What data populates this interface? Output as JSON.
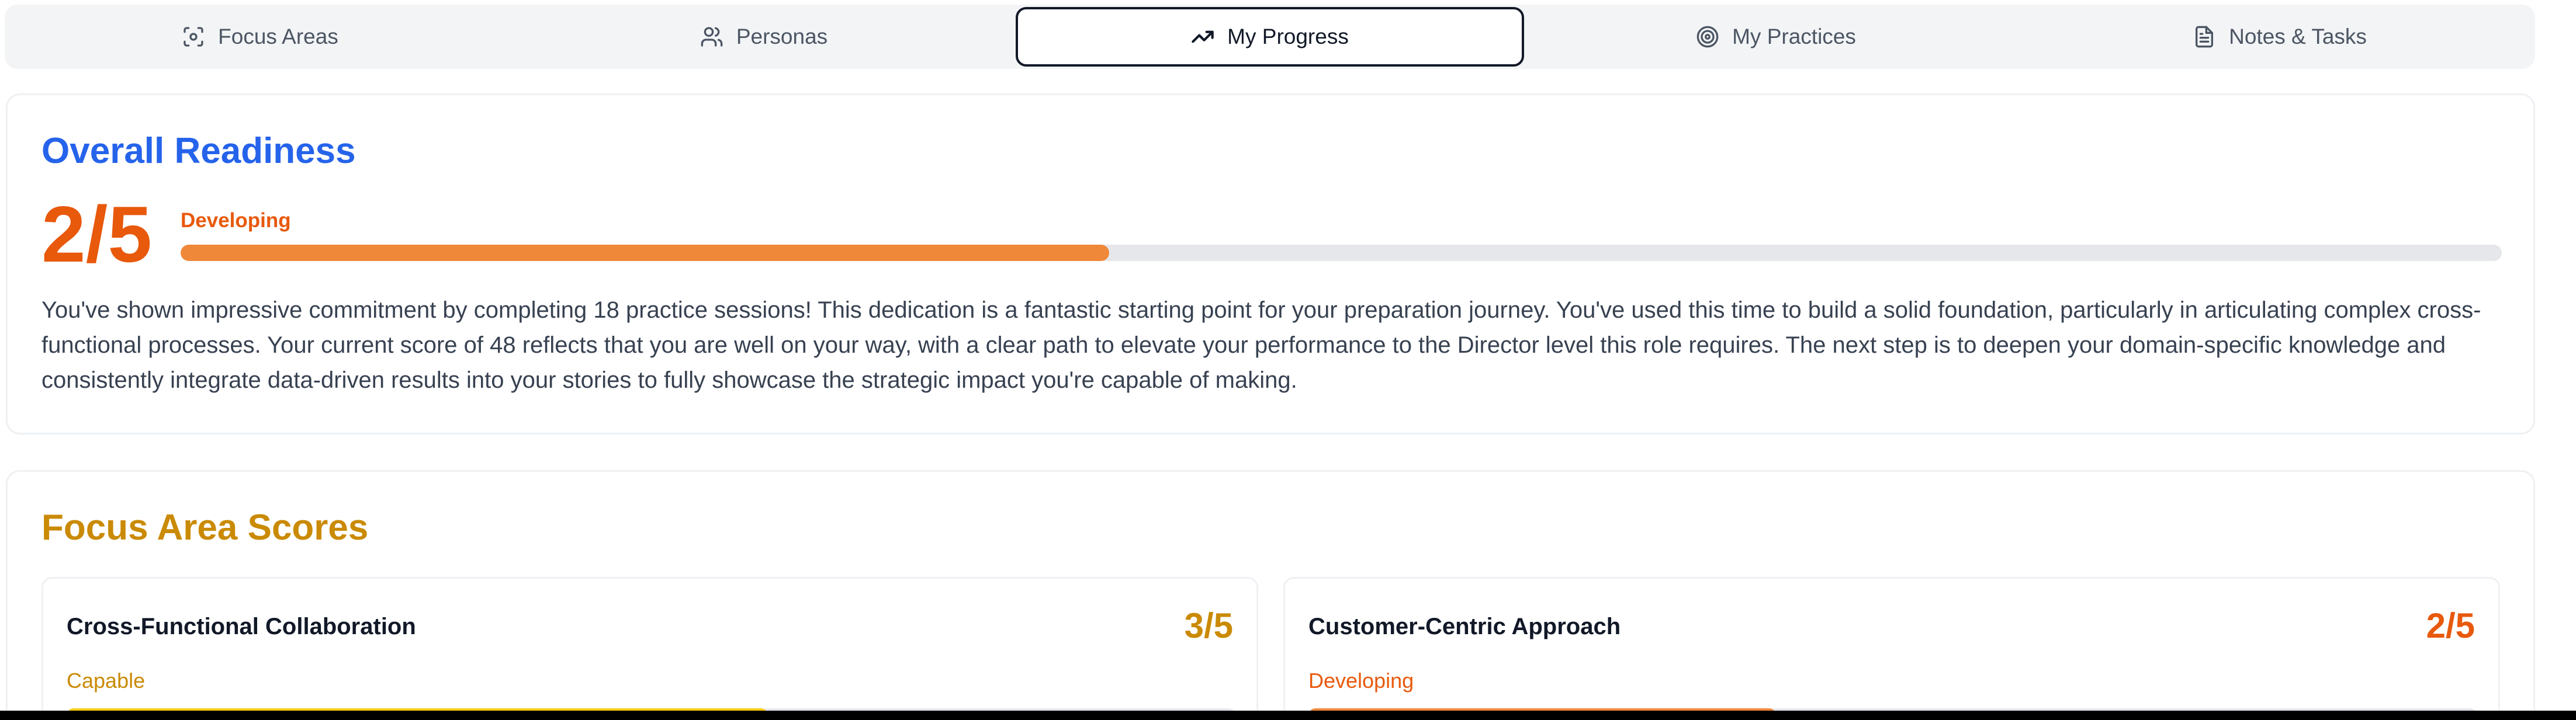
{
  "tabs": [
    {
      "label": "Focus Areas",
      "icon": "focus-icon",
      "active": false
    },
    {
      "label": "Personas",
      "icon": "users-icon",
      "active": false
    },
    {
      "label": "My Progress",
      "icon": "trending-up-icon",
      "active": true
    },
    {
      "label": "My Practices",
      "icon": "target-icon",
      "active": false
    },
    {
      "label": "Notes & Tasks",
      "icon": "file-text-icon",
      "active": false
    }
  ],
  "readiness": {
    "title": "Overall Readiness",
    "score": "2/5",
    "level": "Developing",
    "progress_fraction": 0.4,
    "summary": "You've shown impressive commitment by completing 18 practice sessions! This dedication is a fantastic starting point for your preparation journey. You've used this time to build a solid foundation, particularly in articulating complex cross-functional processes. Your current score of 48 reflects that you are well on your way, with a clear path to elevate your performance to the Director level this role requires. The next step is to deepen your domain-specific knowledge and consistently integrate data-driven results into your stories to fully showcase the strategic impact you're capable of making."
  },
  "focus_scores": {
    "title": "Focus Area Scores",
    "items": [
      {
        "name": "Cross-Functional Collaboration",
        "score": "3/5",
        "level": "Capable",
        "progress_fraction": 0.6,
        "color": "#ca8a04",
        "bar_color": "#facc15"
      },
      {
        "name": "Customer-Centric Approach",
        "score": "2/5",
        "level": "Developing",
        "progress_fraction": 0.4,
        "color": "#e8590c",
        "bar_color": "#f0883a"
      }
    ]
  },
  "colors": {
    "readiness_title": "#2563eb",
    "developing": "#e8590c",
    "capable": "#ca8a04",
    "focus_title": "#ca8a04"
  }
}
